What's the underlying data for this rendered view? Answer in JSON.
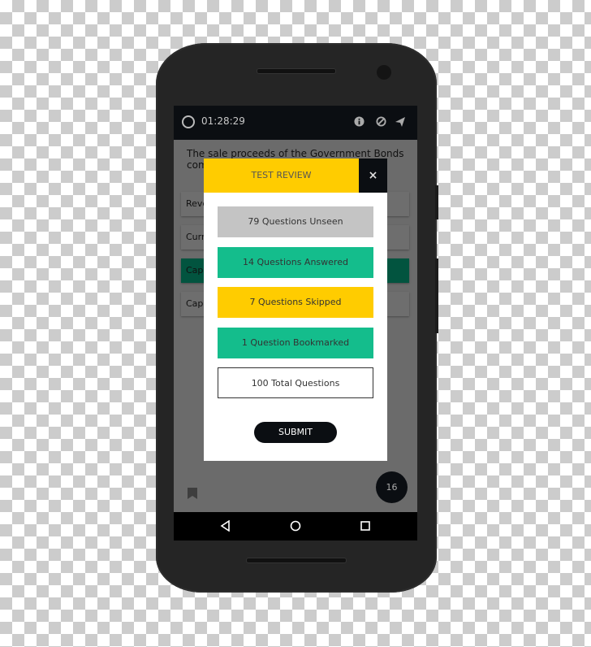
{
  "status_bar": {
    "timer": "01:28:29",
    "icons": [
      "info-icon",
      "block-icon",
      "send-icon"
    ]
  },
  "question": {
    "text": "The sale proceeds of the Government Bonds come under"
  },
  "options": [
    {
      "label": "Revenue"
    },
    {
      "label": "Current"
    },
    {
      "label": "Capital",
      "selected": true
    },
    {
      "label": "Capital"
    }
  ],
  "modal": {
    "title": "TEST REVIEW",
    "close_icon": "×",
    "stats": [
      {
        "label": "79 Questions Unseen",
        "color": "#c4c4c4"
      },
      {
        "label": "14 Questions Answered",
        "color": "#14bd8c"
      },
      {
        "label": "7 Questions Skipped",
        "color": "#ffcc00"
      },
      {
        "label": "1 Question Bookmarked",
        "color": "#14bd8c"
      },
      {
        "label": "100 Total Questions",
        "color": "#ffffff"
      }
    ],
    "submit_label": "SUBMIT"
  },
  "fab": {
    "label": "16"
  },
  "colors": {
    "accent_yellow": "#ffcc00",
    "accent_green": "#14bd8c",
    "dark": "#0b0e12"
  }
}
